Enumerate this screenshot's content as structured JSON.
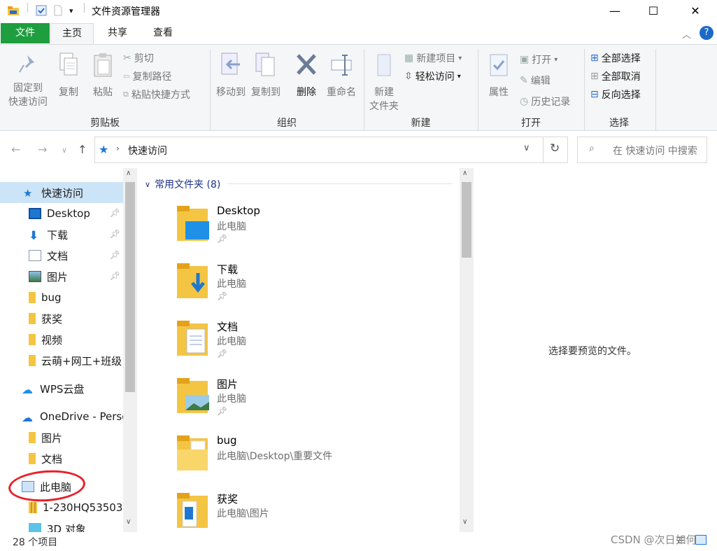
{
  "window": {
    "title": "文件资源管理器",
    "minimize": "—",
    "maximize": "☐",
    "close": "✕"
  },
  "ribbon_tabs": [
    "文件",
    "主页",
    "共享",
    "查看"
  ],
  "ribbon": {
    "clipboard": {
      "label": "剪贴板",
      "pin_quick_access": [
        "固定到",
        "快速访问"
      ],
      "copy": "复制",
      "paste": "粘贴",
      "cut": "剪切",
      "copy_path": "复制路径",
      "paste_shortcut": "粘贴快捷方式"
    },
    "organize": {
      "label": "组织",
      "move_to": "移动到",
      "copy_to": "复制到",
      "delete": "删除",
      "rename": "重命名"
    },
    "new": {
      "label": "新建",
      "new_folder": [
        "新建",
        "文件夹"
      ],
      "new_item": "新建项目",
      "easy_access": "轻松访问"
    },
    "open": {
      "label": "打开",
      "properties": "属性",
      "open": "打开",
      "edit": "编辑",
      "history": "历史记录"
    },
    "select": {
      "label": "选择",
      "select_all": "全部选择",
      "select_none": "全部取消",
      "invert": "反向选择"
    }
  },
  "address": {
    "path": "快速访问",
    "search_placeholder": "在 快速访问 中搜索"
  },
  "nav_pane": {
    "quick_access": "快速访问",
    "items": [
      {
        "label": "Desktop",
        "pinned": true
      },
      {
        "label": "下载",
        "pinned": true
      },
      {
        "label": "文档",
        "pinned": true
      },
      {
        "label": "图片",
        "pinned": true
      },
      {
        "label": "bug",
        "pinned": false
      },
      {
        "label": "获奖",
        "pinned": false
      },
      {
        "label": "视频",
        "pinned": false
      },
      {
        "label": "云萌+网工+班级",
        "pinned": false
      }
    ],
    "wps": "WPS云盘",
    "onedrive": "OneDrive - Perso",
    "onedrive_items": [
      "图片",
      "文档"
    ],
    "this_pc": "此电脑",
    "this_pc_items": [
      "1-230HQ53503",
      "3D 对象"
    ]
  },
  "content": {
    "group_header": "常用文件夹 (8)",
    "folders": [
      {
        "name": "Desktop",
        "path": "此电脑",
        "pinned": true
      },
      {
        "name": "下载",
        "path": "此电脑",
        "pinned": true
      },
      {
        "name": "文档",
        "path": "此电脑",
        "pinned": true
      },
      {
        "name": "图片",
        "path": "此电脑",
        "pinned": true
      },
      {
        "name": "bug",
        "path": "此电脑\\Desktop\\重要文件",
        "pinned": false
      },
      {
        "name": "获奖",
        "path": "此电脑\\图片",
        "pinned": false
      }
    ]
  },
  "preview": {
    "text": "选择要预览的文件。"
  },
  "status": {
    "count": "28 个项目"
  },
  "watermark": "CSDN @次日如何",
  "colors": {
    "file_tab": "#1e9e3e",
    "accent": "#0078d7",
    "folder": "#f4c542",
    "annotation": "#e8202a"
  }
}
